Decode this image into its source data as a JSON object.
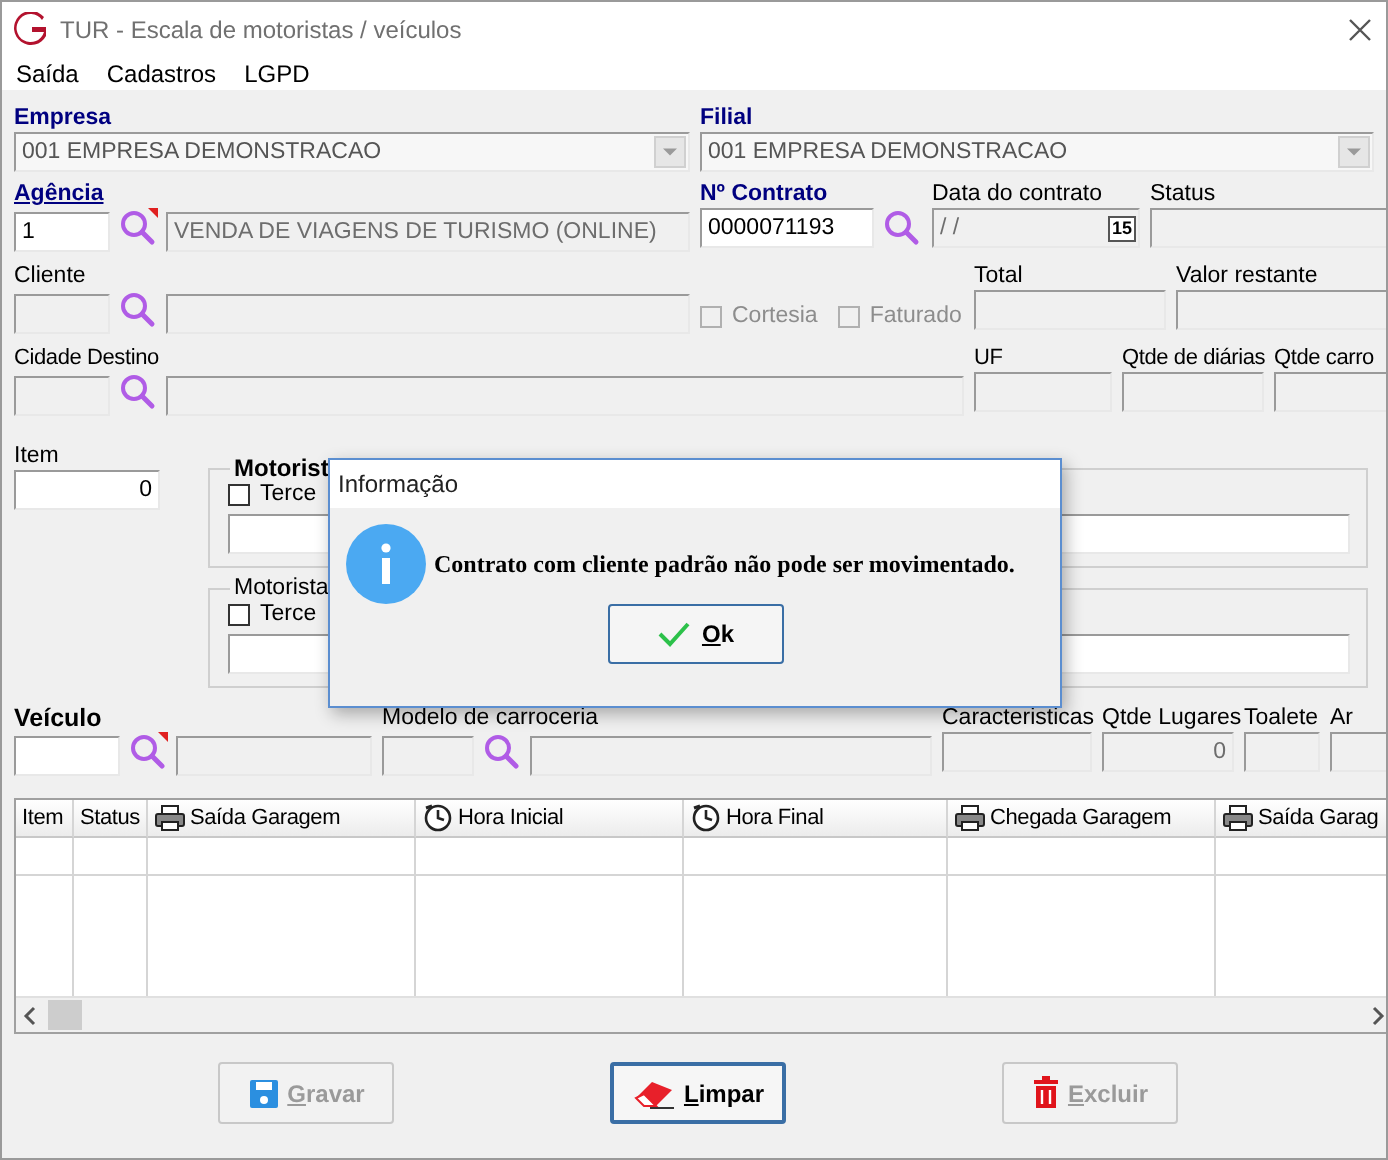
{
  "window": {
    "title": "TUR - Escala de motoristas / veículos"
  },
  "menu": [
    "Saída",
    "Cadastros",
    "LGPD"
  ],
  "empresa": {
    "label": "Empresa",
    "value": "001 EMPRESA DEMONSTRACAO",
    "disabled": true
  },
  "filial": {
    "label": "Filial",
    "value": "001 EMPRESA DEMONSTRACAO",
    "disabled": true
  },
  "agencia": {
    "label": "Agência",
    "code": {
      "value": "1",
      "disabled": false
    },
    "lookup_flagged": true,
    "description": {
      "value": "VENDA DE VIAGENS DE TURISMO (ONLINE)",
      "disabled": true
    }
  },
  "contrato": {
    "label": "Nº Contrato",
    "value": "0000071193",
    "disabled": false
  },
  "data_contrato": {
    "label": "Data do contrato",
    "value": "/ /",
    "calendar": "15",
    "disabled": true
  },
  "status": {
    "label": "Status",
    "disabled": true
  },
  "cliente": {
    "label": "Cliente",
    "code": {
      "disabled": true
    },
    "lookup_flagged": false,
    "description": {
      "disabled": true
    }
  },
  "checkboxes": [
    {
      "label": "Cortesia",
      "checked": false,
      "disabled": true
    },
    {
      "label": "Faturado",
      "checked": false,
      "disabled": true
    }
  ],
  "total": {
    "label": "Total",
    "disabled": true
  },
  "valor_restante": {
    "label": "Valor restante",
    "disabled": true
  },
  "cidade_destino": {
    "label": "Cidade Destino",
    "code": {
      "disabled": true
    },
    "lookup_flagged": false,
    "description": {
      "disabled": true
    }
  },
  "uf": {
    "label": "UF",
    "disabled": true
  },
  "qtde_diarias": {
    "label": "Qtde de diárias",
    "disabled": true
  },
  "qtde_carro": {
    "label": "Qtde carro",
    "disabled": true
  },
  "item": {
    "label": "Item",
    "value": "0",
    "disabled": false
  },
  "driver_groups": [
    {
      "title": "Motorist",
      "bold": true,
      "checkbox": {
        "label": "Terce",
        "checked": false,
        "disabled": false
      },
      "field": {
        "disabled": false
      }
    },
    {
      "title": "Motorista",
      "bold": false,
      "checkbox": {
        "label": "Terce",
        "checked": false,
        "disabled": false
      },
      "field": {
        "disabled": false
      }
    }
  ],
  "veiculo": {
    "label": "Veículo",
    "code": {
      "disabled": false
    },
    "lookup_flagged": true,
    "description": {
      "disabled": true
    }
  },
  "modelo_carroceria": {
    "label": "Modelo de carroceria",
    "code": {
      "disabled": true
    },
    "lookup_flagged": false,
    "description": {
      "disabled": true
    }
  },
  "caracteristicas": {
    "label": "Caracteristicas",
    "disabled": true
  },
  "qtde_lugares": {
    "label": "Qtde Lugares",
    "value": "0",
    "disabled": true
  },
  "toalete": {
    "label": "Toalete",
    "disabled": true
  },
  "ar": {
    "label": "Ar",
    "disabled": true
  },
  "table": {
    "columns": [
      {
        "label": "Item",
        "kind": "plain"
      },
      {
        "label": "Status",
        "kind": "plain"
      },
      {
        "label": "Saída Garagem",
        "kind": "printer"
      },
      {
        "label": "Hora Inicial",
        "kind": "clock"
      },
      {
        "label": "Hora Final",
        "kind": "clock"
      },
      {
        "label": "Chegada Garagem",
        "kind": "printer"
      },
      {
        "label": "Saída Garag",
        "kind": "printer"
      }
    ]
  },
  "buttons": [
    {
      "label": "Gravar",
      "kind": "save",
      "disabled": true,
      "focused": false
    },
    {
      "label": "Limpar",
      "kind": "clear",
      "disabled": false,
      "focused": true
    },
    {
      "label": "Excluir",
      "kind": "delete",
      "disabled": true,
      "focused": false
    }
  ],
  "dialog": {
    "title": "Informação",
    "message": "Contrato com cliente padrão não pode ser movimentado.",
    "button": "Ok"
  }
}
